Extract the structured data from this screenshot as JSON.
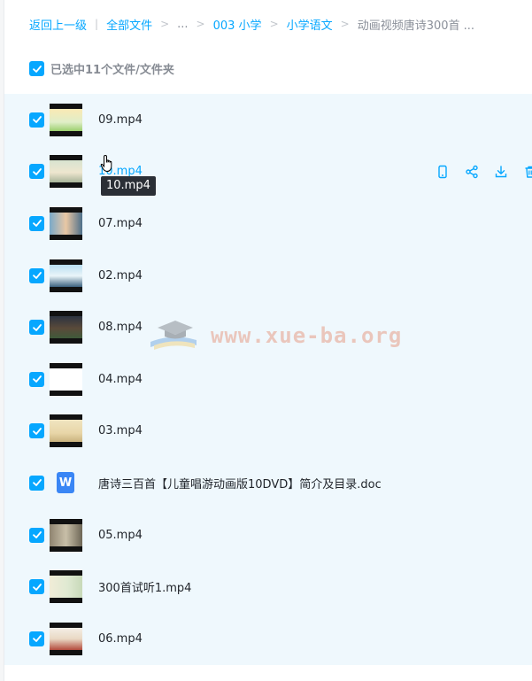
{
  "breadcrumb": {
    "back": "返回上一级",
    "all_files": "全部文件",
    "ellipsis": "...",
    "level1": "003 小学",
    "level2": "小学语文",
    "current": "动画视频唐诗300首 ..."
  },
  "selection": {
    "label": "已选中11个文件/文件夹"
  },
  "tooltip": "10.mp4",
  "watermark": "www.xue-ba.org",
  "colors": {
    "accent": "#06a7ff",
    "row_bg": "#eff8fd",
    "doc_icon": "#3a86f5"
  },
  "files": [
    {
      "name": "09.mp4",
      "type": "video"
    },
    {
      "name": "10.mp4",
      "type": "video"
    },
    {
      "name": "07.mp4",
      "type": "video"
    },
    {
      "name": "02.mp4",
      "type": "video"
    },
    {
      "name": "08.mp4",
      "type": "video"
    },
    {
      "name": "04.mp4",
      "type": "video"
    },
    {
      "name": "03.mp4",
      "type": "video"
    },
    {
      "name": "唐诗三百首【儿童唱游动画版10DVD】简介及目录.doc",
      "type": "doc",
      "icon_letter": "W"
    },
    {
      "name": "05.mp4",
      "type": "video"
    },
    {
      "name": "300首试听1.mp4",
      "type": "video"
    },
    {
      "name": "06.mp4",
      "type": "video"
    }
  ],
  "row_actions": [
    "phone-icon",
    "share-icon",
    "download-icon",
    "delete-icon"
  ]
}
